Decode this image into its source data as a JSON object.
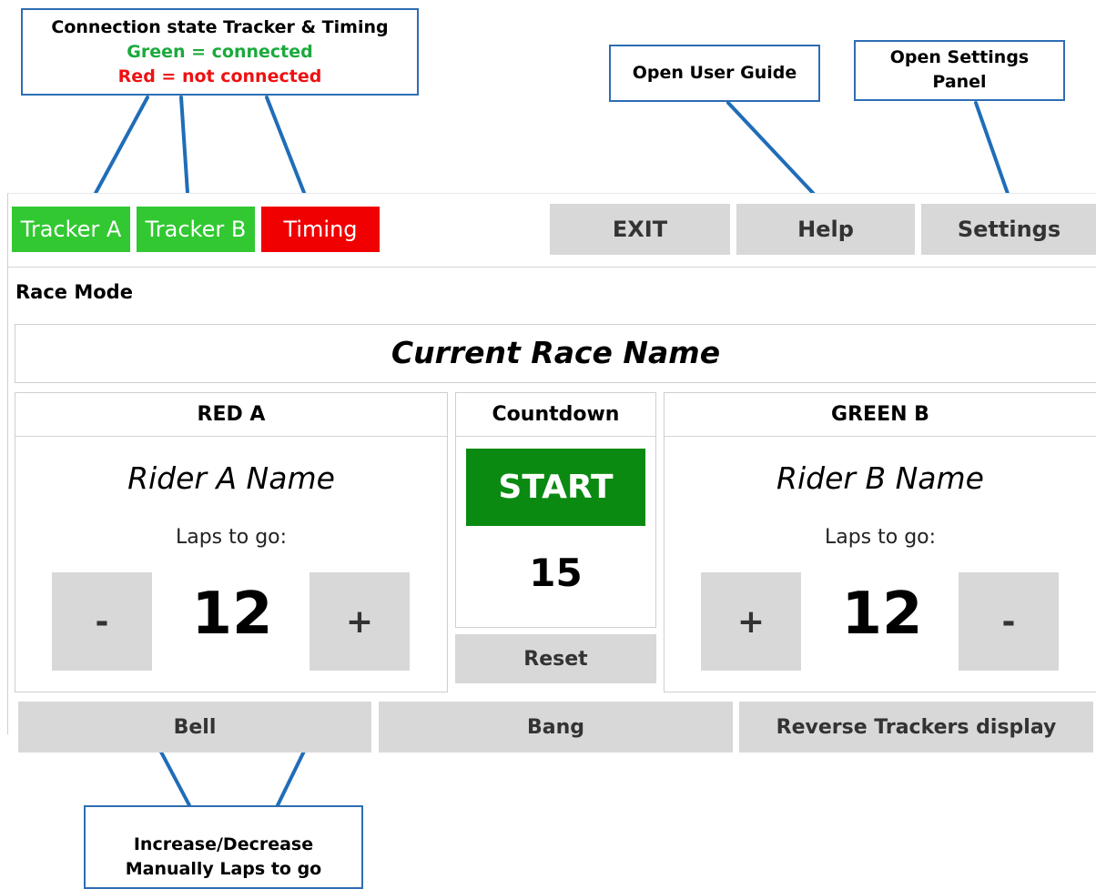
{
  "callouts": {
    "connection": {
      "line1": "Connection state Tracker & Timing",
      "line2": "Green = connected",
      "line3": "Red = not connected"
    },
    "help": {
      "text": "Open User Guide"
    },
    "settings": {
      "line1": "Open Settings",
      "line2": "Panel"
    },
    "laps": {
      "line1": "Increase/Decrease",
      "line2": "Manually Laps to go"
    }
  },
  "status": {
    "tracker_a": {
      "label": "Tracker A",
      "state": "connected",
      "color": "#31c831"
    },
    "tracker_b": {
      "label": "Tracker B",
      "state": "connected",
      "color": "#31c831"
    },
    "timing": {
      "label": "Timing",
      "state": "not connected",
      "color": "#f00000"
    }
  },
  "toolbar": {
    "exit": "EXIT",
    "help": "Help",
    "settings": "Settings"
  },
  "mode_title": "Race Mode",
  "race_name": "Current Race Name",
  "rider_a": {
    "header": "RED A",
    "name": "Rider A Name",
    "laps_label": "Laps to go:",
    "laps": "12",
    "decrease": "-",
    "increase": "+"
  },
  "countdown": {
    "header": "Countdown",
    "start": "START",
    "start_color": "#0b8a12",
    "value": "15",
    "reset": "Reset"
  },
  "rider_b": {
    "header": "GREEN B",
    "name": "Rider B Name",
    "laps_label": "Laps to go:",
    "laps": "12",
    "increase": "+",
    "decrease": "-"
  },
  "bottom": {
    "bell": "Bell",
    "bang": "Bang",
    "reverse": "Reverse Trackers display"
  },
  "colors": {
    "callout_border": "#2e6db4",
    "connector": "#1f6db8"
  }
}
